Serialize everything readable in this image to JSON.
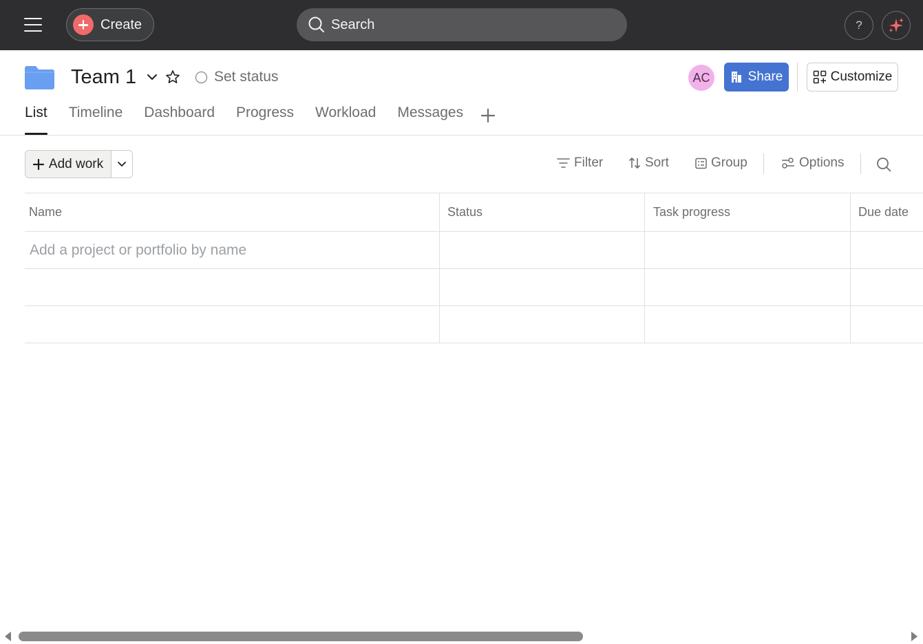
{
  "topbar": {
    "create_label": "Create",
    "search_label": "Search",
    "help_label": "?"
  },
  "project": {
    "title": "Team 1",
    "set_status_label": "Set status",
    "avatar_initials": "AC",
    "share_label": "Share",
    "customize_label": "Customize",
    "icon_color": "#6a9ef0"
  },
  "tabs": [
    {
      "label": "List",
      "active": true
    },
    {
      "label": "Timeline",
      "active": false
    },
    {
      "label": "Dashboard",
      "active": false
    },
    {
      "label": "Progress",
      "active": false
    },
    {
      "label": "Workload",
      "active": false
    },
    {
      "label": "Messages",
      "active": false
    }
  ],
  "toolbar": {
    "add_work_label": "Add work",
    "filter_label": "Filter",
    "sort_label": "Sort",
    "group_label": "Group",
    "options_label": "Options"
  },
  "table": {
    "columns": [
      "Name",
      "Status",
      "Task progress",
      "Due date"
    ],
    "add_placeholder": "Add a project or portfolio by name"
  },
  "colors": {
    "topbar_bg": "#2e2e30",
    "create_accent": "#f06a6a",
    "share_bg": "#4573d2",
    "avatar_bg": "#f1b2e9"
  }
}
